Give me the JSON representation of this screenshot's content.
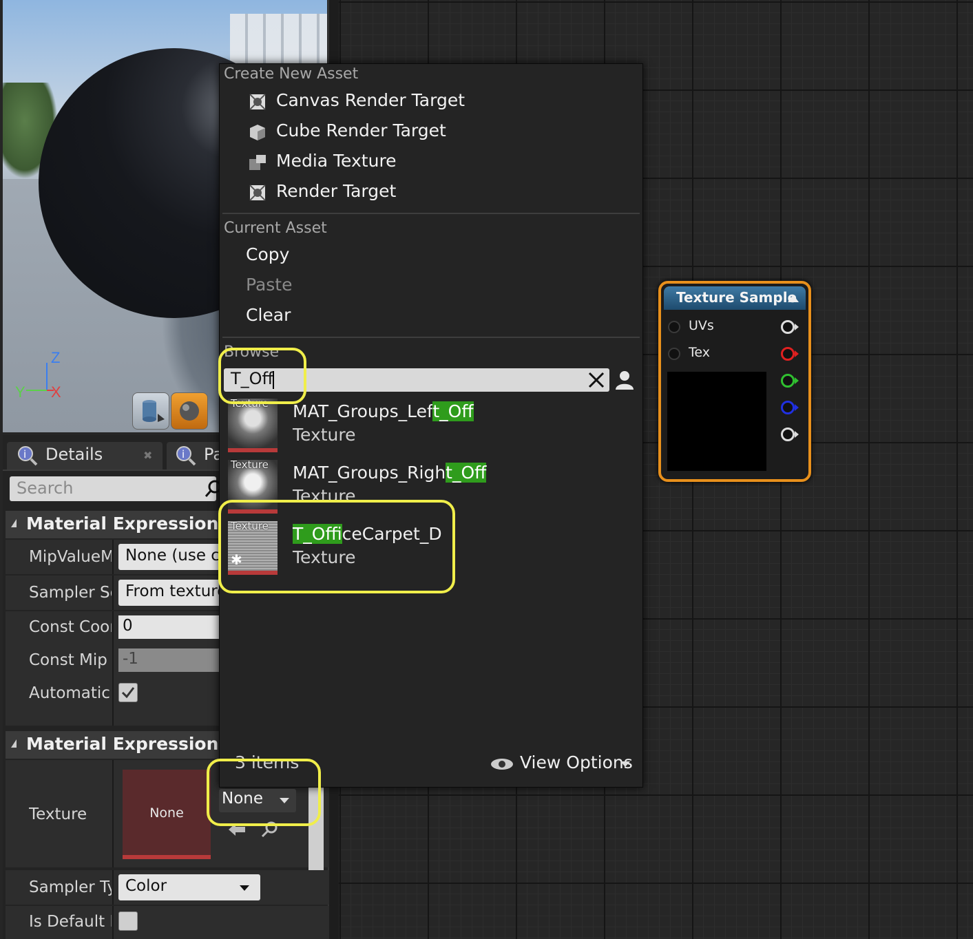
{
  "viewport": {
    "axis_z": "Z",
    "axis_x": "X",
    "axis_y": "Y"
  },
  "details": {
    "tab_details_label": "Details",
    "tab_palette_label": "Pa",
    "search_placeholder": "Search",
    "category1_title": "Material Expression Text",
    "category2_title": "Material Expression Text",
    "properties": [
      {
        "name": "MipValueMc",
        "value": "None (use com"
      },
      {
        "name": "Sampler Sou",
        "value": "From texture a"
      },
      {
        "name": "Const Coord",
        "value": "0"
      },
      {
        "name": "Const Mip V",
        "value": "-1"
      },
      {
        "name": "Automatic V",
        "checked": true
      }
    ],
    "texture_label": "Texture",
    "texture_thumb_text": "None",
    "texture_combo_value": "None",
    "sampler_type_label": "Sampler Typ",
    "sampler_type_value": "Color",
    "is_default_label": "Is Default M"
  },
  "menu": {
    "create_header": "Create New Asset",
    "create_items": [
      {
        "label": "Canvas Render Target",
        "icon": "render-target-icon"
      },
      {
        "label": "Cube Render Target",
        "icon": "cube-render-target-icon"
      },
      {
        "label": "Media Texture",
        "icon": "media-texture-icon"
      },
      {
        "label": "Render Target",
        "icon": "render-target-icon"
      }
    ],
    "current_header": "Current Asset",
    "copy_label": "Copy",
    "paste_label": "Paste",
    "clear_label": "Clear",
    "browse_header": "Browse",
    "search_value": "T_Off",
    "results": [
      {
        "tag": "Texture",
        "name_pre": "MAT_Groups_Lef",
        "name_hl": "t_Off",
        "name_post": "",
        "type": "Texture"
      },
      {
        "tag": "Texture",
        "name_pre": "MAT_Groups_Righ",
        "name_hl": "t_Off",
        "name_post": "",
        "type": "Texture"
      },
      {
        "tag": "Texture",
        "name_pre": "",
        "name_hl": "T_Off",
        "name_post": "iceCarpet_D",
        "type": "Texture"
      }
    ],
    "items_count": "3 items",
    "view_options_label": "View Options"
  },
  "node": {
    "title": "Texture Sample",
    "inputs": [
      "UVs",
      "Tex"
    ],
    "output_colors": [
      "#dddddd",
      "#e02020",
      "#30c030",
      "#2030e0",
      "#dddddd"
    ]
  }
}
